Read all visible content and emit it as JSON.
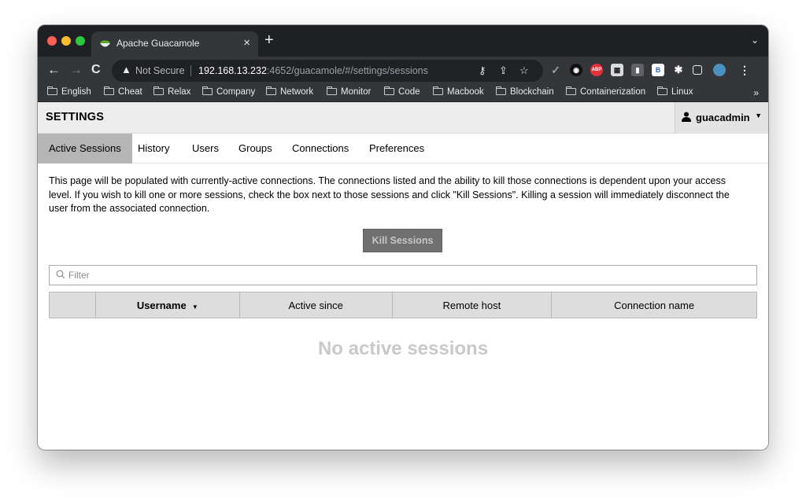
{
  "browser": {
    "tab": {
      "title": "Apache Guacamole",
      "close_glyph": "×",
      "favicon": "guacamole-bowl-icon"
    },
    "new_tab_glyph": "+",
    "tab_search_glyph": "⌄",
    "nav": {
      "back": "←",
      "forward": "→",
      "reload": "C"
    },
    "address": {
      "security_label": "Not Secure",
      "host": "192.168.13.232",
      "rest": ":4652/guacamole/#/settings/sessions"
    },
    "bookmarks": [
      "English",
      "Cheat",
      "Relax",
      "Company",
      "Network",
      "Monitor",
      "Code",
      "Macbook",
      "Blockchain",
      "Containerization",
      "Linux"
    ],
    "bookmarks_more": "»",
    "colors": {
      "tab_strip": "#1f2023",
      "toolbar": "#35363a",
      "omnibox": "#202124"
    }
  },
  "header": {
    "title": "SETTINGS",
    "username": "guacadmin",
    "caret": "▼"
  },
  "tabs": [
    {
      "label": "Active Sessions",
      "active": true
    },
    {
      "label": "History",
      "active": false
    },
    {
      "label": "Users",
      "active": false
    },
    {
      "label": "Groups",
      "active": false
    },
    {
      "label": "Connections",
      "active": false
    },
    {
      "label": "Preferences",
      "active": false
    }
  ],
  "content": {
    "intro": "This page will be populated with currently-active connections. The connections listed and the ability to kill those connections is dependent upon your access level. If you wish to kill one or more sessions, check the box next to those sessions and click \"Kill Sessions\". Killing a session will immediately disconnect the user from the associated connection.",
    "kill_button": "Kill Sessions",
    "filter_placeholder": "Filter",
    "table": {
      "columns": [
        "",
        "Username",
        "Active since",
        "Remote host",
        "Connection name"
      ],
      "sorted_column": "Username",
      "sort_glyph": "▼"
    },
    "empty_message": "No active sessions"
  }
}
